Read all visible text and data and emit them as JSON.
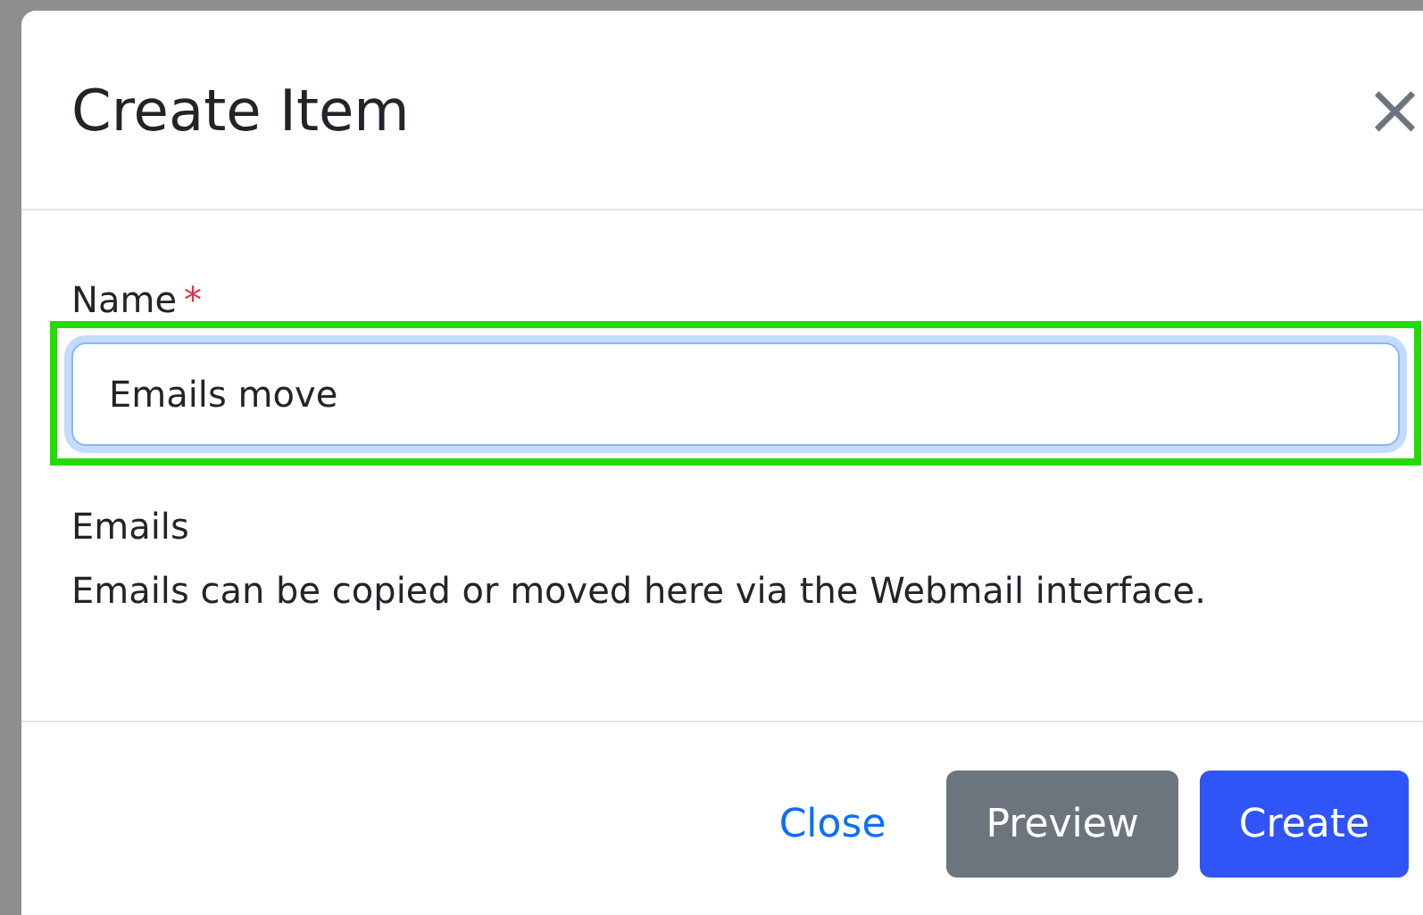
{
  "dialog": {
    "title": "Create Item",
    "close_symbol": "×"
  },
  "name_field": {
    "label": "Name",
    "required_mark": "*",
    "value": "Emails move",
    "focused": true,
    "highlighted": true
  },
  "info": {
    "heading": "Emails",
    "description": "Emails can be copied or moved here via the Webmail interface."
  },
  "buttons": [
    {
      "label": "Close",
      "kind": "link"
    },
    {
      "label": "Preview",
      "kind": "secondary"
    },
    {
      "label": "Create",
      "kind": "primary"
    }
  ]
}
